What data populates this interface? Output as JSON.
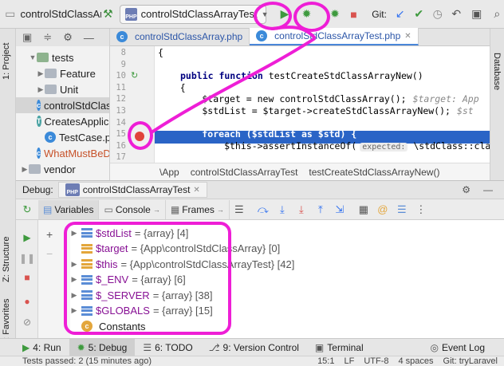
{
  "toolbar": {
    "project": "controlStdClassArrayTest",
    "run_config": "controlStdClassArrayTest",
    "git_label": "Git:"
  },
  "left_stripe": {
    "project_tab": "1: Project",
    "structure_tab": "Z: Structure",
    "favorites_tab": "2: Favorites"
  },
  "right_stripe": {
    "database_tab": "Database"
  },
  "project_tree": [
    {
      "label": "tests",
      "kind": "folder-green",
      "indent": 1,
      "open": true
    },
    {
      "label": "Feature",
      "kind": "folder",
      "indent": 2,
      "open": false
    },
    {
      "label": "Unit",
      "kind": "folder",
      "indent": 2,
      "open": false
    },
    {
      "label": "controlStdClassArrayTest.php",
      "kind": "class",
      "indent": 2,
      "selected": true
    },
    {
      "label": "CreatesApplication.php",
      "kind": "trait",
      "indent": 2
    },
    {
      "label": "TestCase.php",
      "kind": "class",
      "indent": 2
    },
    {
      "label": "WhatMustBeDone",
      "kind": "class-orange",
      "indent": 2
    },
    {
      "label": "vendor",
      "kind": "folder",
      "indent": 0,
      "open": false
    }
  ],
  "editor": {
    "tabs": [
      {
        "label": "controlStdClassArray.php",
        "active": false
      },
      {
        "label": "controlStdClassArrayTest.php",
        "active": true
      }
    ],
    "lines": [
      {
        "num": "8",
        "text": "{"
      },
      {
        "num": "9",
        "text": ""
      },
      {
        "num": "10",
        "kw": "public function ",
        "text": "testCreateStdClassArrayNew()"
      },
      {
        "num": "11",
        "text": "    {"
      },
      {
        "num": "12",
        "text": "        $target = new controlStdClassArray();",
        "hint": "$target: App"
      },
      {
        "num": "13",
        "text": "        $stdList = $target->createStdClassArrayNew();",
        "hint": "$st"
      },
      {
        "num": "14",
        "text": ""
      },
      {
        "num": "15",
        "text": "        foreach ($stdList as $std) {"
      },
      {
        "num": "16",
        "text": "            $this->assertInstanceOf(",
        "param": "expected:",
        "tail": " \\stdClass::cla"
      },
      {
        "num": "17",
        "text": ""
      }
    ],
    "breadcrumb": [
      "\\App",
      "controlStdClassArrayTest",
      "testCreateStdClassArrayNew()"
    ]
  },
  "debug": {
    "label": "Debug:",
    "session": "controlStdClassArrayTest",
    "tabs": [
      {
        "label": "Variables",
        "active": true
      },
      {
        "label": "Console",
        "active": false
      },
      {
        "label": "Frames",
        "active": false
      }
    ],
    "variables": [
      {
        "name": "$stdList",
        "value": "= {array} [4]",
        "expandable": true,
        "icon": "blue"
      },
      {
        "name": "$target",
        "value": "= {App\\controlStdClassArray} [0]",
        "expandable": false,
        "icon": "orange"
      },
      {
        "name": "$this",
        "value": "= {App\\controlStdClassArrayTest} [42]",
        "expandable": true,
        "icon": "orange"
      },
      {
        "name": "$_ENV",
        "value": "= {array} [6]",
        "expandable": true,
        "icon": "blue"
      },
      {
        "name": "$_SERVER",
        "value": "= {array} [38]",
        "expandable": true,
        "icon": "blue"
      },
      {
        "name": "$GLOBALS",
        "value": "= {array} [15]",
        "expandable": true,
        "icon": "blue"
      },
      {
        "name": "Constants",
        "value": "",
        "expandable": false,
        "icon": "const"
      }
    ]
  },
  "bottom_tabs": [
    {
      "label": "4: Run",
      "active": false
    },
    {
      "label": "5: Debug",
      "active": true
    },
    {
      "label": "6: TODO",
      "active": false
    },
    {
      "label": "9: Version Control",
      "active": false
    },
    {
      "label": "Terminal",
      "active": false
    }
  ],
  "event_log": "Event Log",
  "status": {
    "message": "Tests passed: 2 (15 minutes ago)",
    "position": "15:1",
    "line_sep": "LF",
    "encoding": "UTF-8",
    "indent": "4 spaces",
    "git": "Git: tryLaravel"
  },
  "colors": {
    "annotation": "#ee1ed6",
    "exec_line": "#2a64c6",
    "accent": "#3574f0"
  }
}
